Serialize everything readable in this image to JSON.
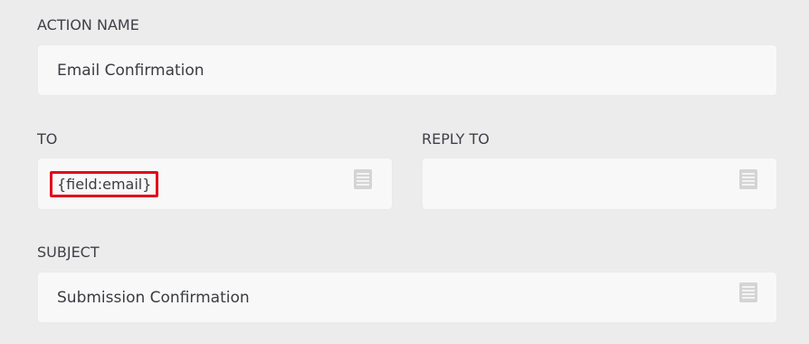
{
  "action_name": {
    "label": "ACTION NAME",
    "value": "Email Confirmation"
  },
  "to": {
    "label": "TO",
    "value": "{field:email}",
    "icon": "merge-tags-icon"
  },
  "reply_to": {
    "label": "REPLY TO",
    "value": "",
    "icon": "merge-tags-icon"
  },
  "subject": {
    "label": "SUBJECT",
    "value": "Submission Confirmation",
    "icon": "merge-tags-icon"
  },
  "colors": {
    "background": "#ececed",
    "field_background": "#f8f8f8",
    "highlight": "#e3071b",
    "icon": "#d2d2d2"
  }
}
